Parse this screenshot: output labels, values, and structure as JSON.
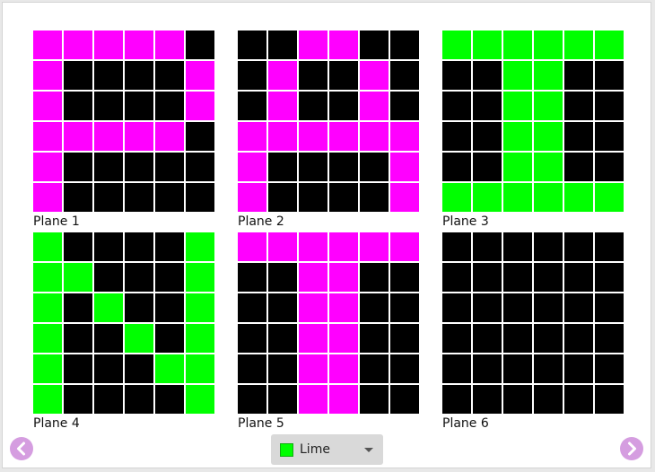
{
  "colors": {
    "off": "#000000",
    "magenta": "#ff00ff",
    "lime": "#00ff00",
    "nav": "#d59de0"
  },
  "planes": [
    {
      "label": "Plane 1",
      "color": "#ff00ff",
      "rows": [
        "111110",
        "100001",
        "100001",
        "111110",
        "100000",
        "100000"
      ]
    },
    {
      "label": "Plane 2",
      "color": "#ff00ff",
      "rows": [
        "001100",
        "010010",
        "010010",
        "111111",
        "100001",
        "100001"
      ]
    },
    {
      "label": "Plane 3",
      "color": "#00ff00",
      "rows": [
        "111111",
        "001100",
        "001100",
        "001100",
        "001100",
        "111111"
      ]
    },
    {
      "label": "Plane 4",
      "color": "#00ff00",
      "rows": [
        "100001",
        "110001",
        "101001",
        "100101",
        "100011",
        "100001"
      ]
    },
    {
      "label": "Plane 5",
      "color": "#ff00ff",
      "rows": [
        "111111",
        "001100",
        "001100",
        "001100",
        "001100",
        "001100"
      ]
    },
    {
      "label": "Plane 6",
      "color": "#00ff00",
      "rows": [
        "000000",
        "000000",
        "000000",
        "000000",
        "000000",
        "000000"
      ]
    }
  ],
  "color_picker": {
    "selected": "Lime",
    "swatch": "#00ff00"
  },
  "nav": {
    "prev_icon": "chevron-left-icon",
    "next_icon": "chevron-right-icon",
    "dropdown_icon": "caret-down-icon"
  }
}
